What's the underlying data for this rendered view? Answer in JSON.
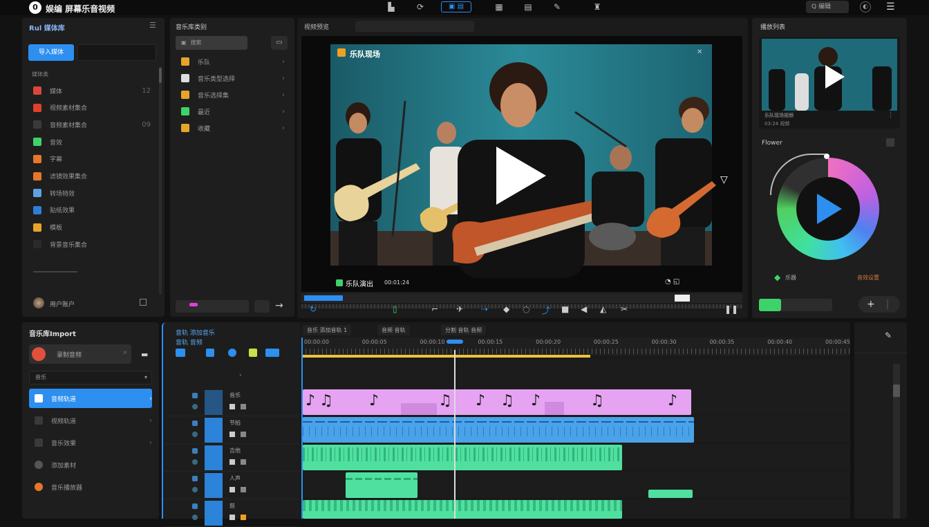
{
  "app": {
    "title": "娱编 屏幕乐音视频"
  },
  "topbar": {
    "tools": [
      "doc-icon",
      "refresh-icon",
      "camera-icon",
      "grid-icon",
      "folder-icon",
      "edit-icon",
      "user-icon"
    ],
    "search_label": "Q 编辑"
  },
  "left_panel": {
    "title": "Rul 媒体库",
    "primary_button": "导入媒体",
    "section_label": "媒体类",
    "items": [
      {
        "label": "媒体",
        "badge": "12",
        "color": "#d9473b"
      },
      {
        "label": "视频素材集合",
        "badge": "",
        "color": "#e0402b"
      },
      {
        "label": "音频素材集合",
        "badge": "09",
        "color": "#3a3a3a"
      },
      {
        "label": "音效",
        "badge": "",
        "color": "#3ed36a"
      },
      {
        "label": "字幕",
        "badge": "",
        "color": "#e6762a"
      },
      {
        "label": "滤镜效果集合",
        "badge": "",
        "color": "#e6762a"
      },
      {
        "label": "转场特效",
        "badge": "",
        "color": "#5fa0e0"
      },
      {
        "label": "贴纸效果",
        "badge": "",
        "color": "#2d7fd6"
      },
      {
        "label": "模板",
        "badge": "",
        "color": "#e6a52a"
      },
      {
        "label": "背景音乐集合",
        "badge": "",
        "color": "#2a2a2a"
      }
    ],
    "user_label": "用户账户"
  },
  "second_panel": {
    "title": "音乐库类别",
    "search_placeholder": "搜索",
    "items": [
      {
        "label": "乐队",
        "color": "#e6a52a"
      },
      {
        "label": "音乐类型选择",
        "color": "#ddd"
      },
      {
        "label": "音乐选择集",
        "color": "#e6a52a"
      },
      {
        "label": "最近",
        "color": "#3ed36a"
      },
      {
        "label": "收藏",
        "color": "#e6a52a"
      }
    ]
  },
  "preview": {
    "tab_label": "视频预览",
    "title_in_video": "乐队现场",
    "bottom_left_label": "乐队演出",
    "bottom_time": "00:01:24",
    "controls": [
      "rewind-icon",
      "scissors-icon",
      "split-icon",
      "drop-icon",
      "loop-icon",
      "arrow-icon",
      "square-icon",
      "volume-icon",
      "speaker-icon",
      "cut-icon",
      "pause-icon",
      "pause-icon-2",
      "export-icon"
    ]
  },
  "right_panel": {
    "title": "播放列表",
    "thumb_caption": "乐队现场视频",
    "thumb_subcaption": "03:24 视频",
    "effects_title": "Flower",
    "green_label": "乐器",
    "orange_label": "音效设置",
    "add_label": "+"
  },
  "bottom_left": {
    "title": "音乐库Import",
    "record_label": "录制音频",
    "dropdown_label": "音乐",
    "items": [
      "音频轨道",
      "视频轨道",
      "音乐效果",
      "添加素材",
      "音乐播放器"
    ]
  },
  "timeline": {
    "header_labels": [
      "音轨 添加音乐",
      "音轨 音频"
    ],
    "tabs": [
      "音乐 添加音轨 1",
      "音频 音轨",
      "分割 音轨 音频"
    ],
    "ruler": [
      "00:00:00",
      "00:00:05",
      "00:00:10",
      "00:00:15",
      "00:00:20",
      "00:00:25",
      "00:00:30",
      "00:00:35",
      "00:00:40",
      "00:00:45"
    ],
    "tracks": [
      {
        "name": "音乐",
        "color": "#e6a3f2"
      },
      {
        "name": "节拍",
        "color": "#4aa3e8"
      },
      {
        "name": "吉他",
        "color": "#4fe0a0"
      },
      {
        "name": "人声",
        "color": "#4fe0a0"
      },
      {
        "name": "鼓",
        "color": "#4fe0a0"
      }
    ]
  },
  "colors": {
    "accent": "#2d8ff0",
    "purple": "#e6a3f2",
    "green": "#4fe0a0",
    "yellow": "#f0c23a",
    "blue_clip": "#4aa3e8"
  }
}
